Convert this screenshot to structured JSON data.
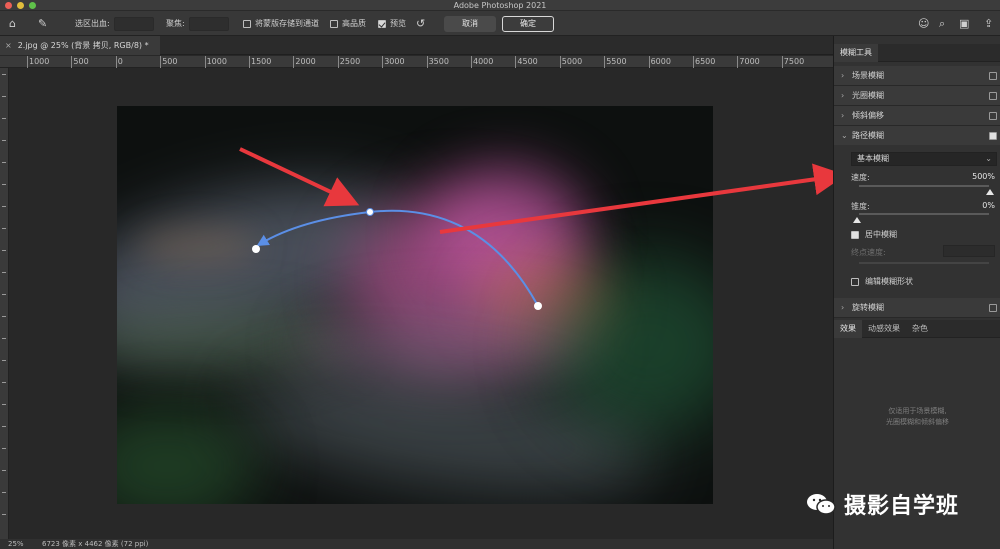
{
  "app": {
    "title": "Adobe Photoshop 2021"
  },
  "options_bar": {
    "selection_bleed_label": "选区出血:",
    "focus_label": "聚焦:",
    "save_mask_label": "将蒙版存储到通道",
    "high_quality_label": "高品质",
    "preview_label": "预览",
    "cancel_label": "取消",
    "ok_label": "确定"
  },
  "document": {
    "tab_title": "2.jpg @ 25% (背景 拷贝, RGB/8) *",
    "close_glyph": "×"
  },
  "ruler": {
    "labels": [
      "1000",
      "500",
      "0",
      "500",
      "1000",
      "1500",
      "2000",
      "2500",
      "3000",
      "3500",
      "4000",
      "4500",
      "5000",
      "5500",
      "6000",
      "6500",
      "7000",
      "7500"
    ]
  },
  "status_bar": {
    "zoom": "25%",
    "doc_info": "6723 像素 x 4462 像素 (72 ppi)"
  },
  "panel": {
    "title": "模糊工具",
    "field_blur": "场景模糊",
    "iris_blur": "光圈模糊",
    "tilt_shift": "倾斜偏移",
    "path_blur": "路径模糊",
    "blur_type": "基本模糊",
    "speed_label": "速度:",
    "speed_value": "500%",
    "taper_label": "锥度:",
    "taper_value": "0%",
    "centered_blur_label": "居中模糊",
    "end_speed_label": "终点速度:",
    "edit_shapes_label": "编辑模糊形状",
    "spin_blur": "旋转模糊",
    "tabs": [
      "效果",
      "动感效果",
      "杂色"
    ],
    "hint_line1": "仅适用于场景模糊,",
    "hint_line2": "光圈模糊和倾斜偏移"
  },
  "watermark": {
    "text": "摄影自学班"
  },
  "colors": {
    "annotation_red": "#e8383d",
    "blur_path_blue": "#5b8fe6",
    "accent": "#d8d8d8"
  },
  "icons": [
    "home-icon",
    "pin-icon",
    "reset-icon",
    "user-icon",
    "search-icon",
    "workspace-icon",
    "share-icon"
  ]
}
